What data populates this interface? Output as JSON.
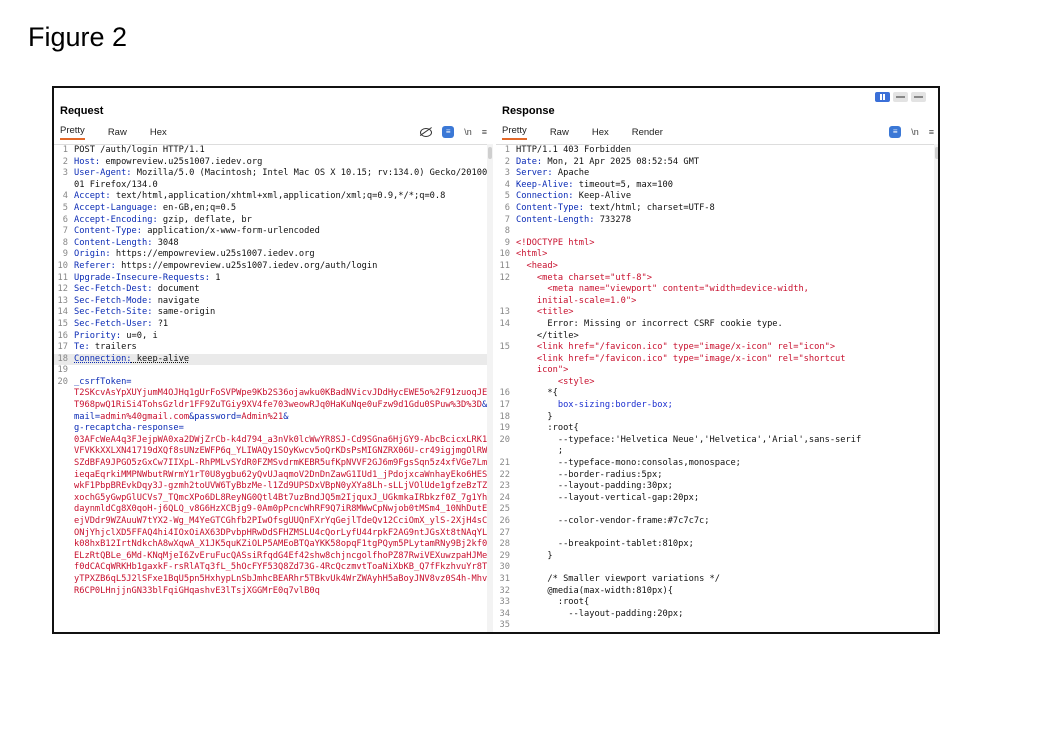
{
  "figure_title": "Figure 2",
  "request": {
    "title": "Request",
    "tabs": [
      "Pretty",
      "Raw",
      "Hex"
    ],
    "lines": [
      {
        "n": "1",
        "t": "POST /auth/login HTTP/1.1"
      },
      {
        "n": "2",
        "k": "Host:",
        "v": " empowreview.u25s1007.iedev.org"
      },
      {
        "n": "3",
        "k": "User-Agent:",
        "v": " Mozilla/5.0 (Macintosh; Intel Mac OS X 10.15; rv:134.0) Gecko/20100101 Firefox/134.0"
      },
      {
        "n": "4",
        "k": "Accept:",
        "v": " text/html,application/xhtml+xml,application/xml;q=0.9,*/*;q=0.8"
      },
      {
        "n": "5",
        "k": "Accept-Language:",
        "v": " en-GB,en;q=0.5"
      },
      {
        "n": "6",
        "k": "Accept-Encoding:",
        "v": " gzip, deflate, br"
      },
      {
        "n": "7",
        "k": "Content-Type:",
        "v": " application/x-www-form-urlencoded"
      },
      {
        "n": "8",
        "k": "Content-Length:",
        "v": " 3048"
      },
      {
        "n": "9",
        "k": "Origin:",
        "v": " https://empowreview.u25s1007.iedev.org"
      },
      {
        "n": "10",
        "k": "Referer:",
        "v": " https://empowreview.u25s1007.iedev.org/auth/login"
      },
      {
        "n": "11",
        "k": "Upgrade-Insecure-Requests:",
        "v": " 1"
      },
      {
        "n": "12",
        "k": "Sec-Fetch-Dest:",
        "v": " document"
      },
      {
        "n": "13",
        "k": "Sec-Fetch-Mode:",
        "v": " navigate"
      },
      {
        "n": "14",
        "k": "Sec-Fetch-Site:",
        "v": " same-origin"
      },
      {
        "n": "15",
        "k": "Sec-Fetch-User:",
        "v": " ?1"
      },
      {
        "n": "16",
        "k": "Priority:",
        "v": " u=0, i"
      },
      {
        "n": "17",
        "k": "Te:",
        "v": " trailers"
      },
      {
        "n": "18",
        "k": "Connection:",
        "v": " keep-alive",
        "hl": true
      },
      {
        "n": "19",
        "t": ""
      }
    ],
    "body": {
      "n": "20",
      "csrf_key": "_csrfToken=",
      "csrf_val": "T2SKcvAsYpXUYjumM4OJHq1gUrFoSVPWpe9Kb2S36ojawku0KBadNVicvJDdHycEWE5o%2F91zuoqJEET968pwQ1RiSi4TohsGzldr1FF9ZuTGiy9XV4fe703weowRJq0HaKuNqe0uFzw9d1Gdu0SPuw%3D%3D",
      "email_sep": "&email=",
      "email_val": "admin%40gmail.com",
      "password_sep": "&password=",
      "password_val": "Admin%21",
      "amp": "&",
      "recaptcha_key": "g-recaptcha-response=",
      "recaptcha_val": "03AFcWeA4q3FJejpWA0xa2DWjZrCb-k4d794_a3nVk0lcWwYR8SJ-Cd9SGna6HjGY9-AbcBcicxLRK1fVFVKkXXLXN41719dXQf8sUNzEWFP6q_YLIWAQy1SOyKwcv5oQrKDsPsMIGNZRX06U-cr49igjmgOlRW3SZdBFA9JPGO5zGxCw7IIXpL-RhPMLvSYdR0FZMSvdrmKEBR5ufKpNVVF2GJ6m9FgsSqn5z4xfVGe7LmfieqaEqrkiMMPNWbutRWrmY1rT0U8ygbu62yQvUJaqmoV2DnDnZawG1IUd1_jPdojxcaWnhayEko6HESqwkF1PbpBREvkDqy3J-gzmh2toUVW6TyBbzMe-l1Zd9UPSDxVBpN0yXYa8Lh-sLLjVOlUde1gfzeBzTZjxochG5yGwpGlUCVs7_TQmcXPo6DL8ReyNG0Qtl4Bt7uzBndJQ5m2IjquxJ_UGkmkaIRbkzf0Z_7g1YhgdaynmldCg8X0qoH-j6QLQ_v8G6HzXCBjg9-0Am0pPcncWhRF9Q7iR8MWwCpNwjob0tMSm4_10NhDutEIejVDdr9WZAuuW7tYX2-Wg_M4YeGTCGhfb2PIwOfsgUUQnFXrYqGejlTdeQv12CciOmX_ylS-2XjH4sCNONjYhjclXD5FFAQ4hi4IOxOiAX63DPvbpHRwDdSFHZMSLU4cQorLyfU44rpkF2AG9ntJGsXt8tNAqYLCk08hxB12IrtNdkchA8wXqwA_X1JK5quKZiOLP5AMEoBTQaYKK58opqF1tgPQym5PLytamRNy9Bj2kf0JELzRtQBLe_6Md-KNqMjeI6ZvEruFucQASsiRfqdG4Ef42shw8chjncgolfhoPZ87RwiVEXuwzpaHJMeQf0dCACqWRKHb1gaxkF-rsRlATq3fL_5hOcFYF53Q8Zd73G-4RcQczmvtToaNiXbKB_Q7fFkzhvuYr8TpyTPXZB6qL5J2lSFxe1BqU5pn5HxhypLnSbJmhcBEARhr5TBkvUk4WrZWAyhH5aBoyJNV8vz0S4h-MhvDR6CP0LHnjjnGN33blFqiGHqashvE3lTsjXGGMrE0q7vlB0q"
    }
  },
  "response": {
    "title": "Response",
    "tabs": [
      "Pretty",
      "Raw",
      "Hex",
      "Render"
    ],
    "lines": [
      {
        "n": "1",
        "t": "HTTP/1.1 403 Forbidden"
      },
      {
        "n": "2",
        "k": "Date:",
        "v": " Mon, 21 Apr 2025 08:52:54 GMT"
      },
      {
        "n": "3",
        "k": "Server:",
        "v": " Apache"
      },
      {
        "n": "4",
        "k": "Keep-Alive:",
        "v": " timeout=5, max=100"
      },
      {
        "n": "5",
        "k": "Connection:",
        "v": " Keep-Alive"
      },
      {
        "n": "6",
        "k": "Content-Type:",
        "v": " text/html; charset=UTF-8"
      },
      {
        "n": "7",
        "k": "Content-Length:",
        "v": " 733278"
      },
      {
        "n": "8",
        "t": ""
      },
      {
        "n": "9",
        "t": "<!DOCTYPE html>",
        "c": "tag"
      },
      {
        "n": "10",
        "t": "<html>",
        "c": "tag"
      },
      {
        "n": "11",
        "t": "  <head>",
        "c": "tag"
      },
      {
        "n": "12",
        "html": "    <meta charset=\"utf-8\">\n      <meta name=\"viewport\" content=\"width=device-width,\n    initial-scale=1.0\">"
      },
      {
        "n": "13",
        "t": "    <title>",
        "c": "tag"
      },
      {
        "n": "14",
        "t": "      Error: Missing or incorrect CSRF cookie type.\n    </title>"
      },
      {
        "n": "15",
        "html": "    <link href=\"/favicon.ico\" type=\"image/x-icon\" rel=\"icon\">\n    <link href=\"/favicon.ico\" type=\"image/x-icon\" rel=\"shortcut\n    icon\">\n        <style>"
      },
      {
        "n": "16",
        "t": "      *{"
      },
      {
        "n": "17",
        "t": "        box-sizing:border-box;",
        "c": "prop"
      },
      {
        "n": "18",
        "t": "      }"
      },
      {
        "n": "19",
        "t": "      :root{"
      },
      {
        "n": "20",
        "t": "        --typeface:'Helvetica Neue','Helvetica','Arial',sans-serif\n        ;"
      },
      {
        "n": "21",
        "t": "        --typeface-mono:consolas,monospace;\n"
      },
      {
        "n": "22",
        "t": "        --border-radius:5px;"
      },
      {
        "n": "23",
        "t": "        --layout-padding:30px;"
      },
      {
        "n": "24",
        "t": "        --layout-vertical-gap:20px;\n"
      },
      {
        "n": "25",
        "t": ""
      },
      {
        "n": "26",
        "t": "        --color-vendor-frame:#7c7c7c;\n"
      },
      {
        "n": "27",
        "t": ""
      },
      {
        "n": "28",
        "t": "        --breakpoint-tablet:810px;"
      },
      {
        "n": "29",
        "t": "      }"
      },
      {
        "n": "30",
        "t": ""
      },
      {
        "n": "31",
        "t": "      /* Smaller viewport variations */"
      },
      {
        "n": "32",
        "t": "      @media(max-width:810px){"
      },
      {
        "n": "33",
        "t": "        :root{"
      },
      {
        "n": "34",
        "t": "          --layout-padding:20px;"
      },
      {
        "n": "35",
        "t": ""
      }
    ]
  },
  "tools": {
    "newline": "\\n",
    "menu": "≡"
  }
}
